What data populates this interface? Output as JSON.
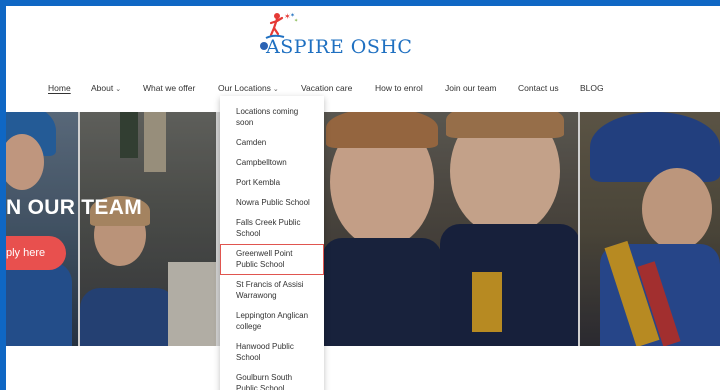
{
  "logo": {
    "text": "ASPIRE OSHC"
  },
  "nav": {
    "items": [
      {
        "label": "Home",
        "active": true
      },
      {
        "label": "About",
        "caret": "⌄"
      },
      {
        "label": "What we offer"
      },
      {
        "label": "Our Locations",
        "caret": "⌄"
      },
      {
        "label": "Vacation care"
      },
      {
        "label": "How to enrol"
      },
      {
        "label": "Join our team"
      },
      {
        "label": "Contact us"
      },
      {
        "label": "BLOG"
      }
    ]
  },
  "hero": {
    "title": "N OUR TEAM",
    "button": "ply here"
  },
  "locations_dropdown": {
    "items": [
      "Locations coming soon",
      "Camden",
      "Campbelltown",
      "Port Kembla",
      "Nowra Public School",
      "Falls Creek Public School",
      "Greenwell Point Public School",
      "St Francis of Assisi Warrawong",
      "Leppington Anglican college",
      "Hanwood Public School",
      "Goulburn South Public School"
    ],
    "highlighted_index": 6
  },
  "colors": {
    "frame_border": "#0f67c4",
    "logo_blue": "#1f70c1",
    "button": "#e8504e",
    "highlight_outline": "#e0554f"
  }
}
